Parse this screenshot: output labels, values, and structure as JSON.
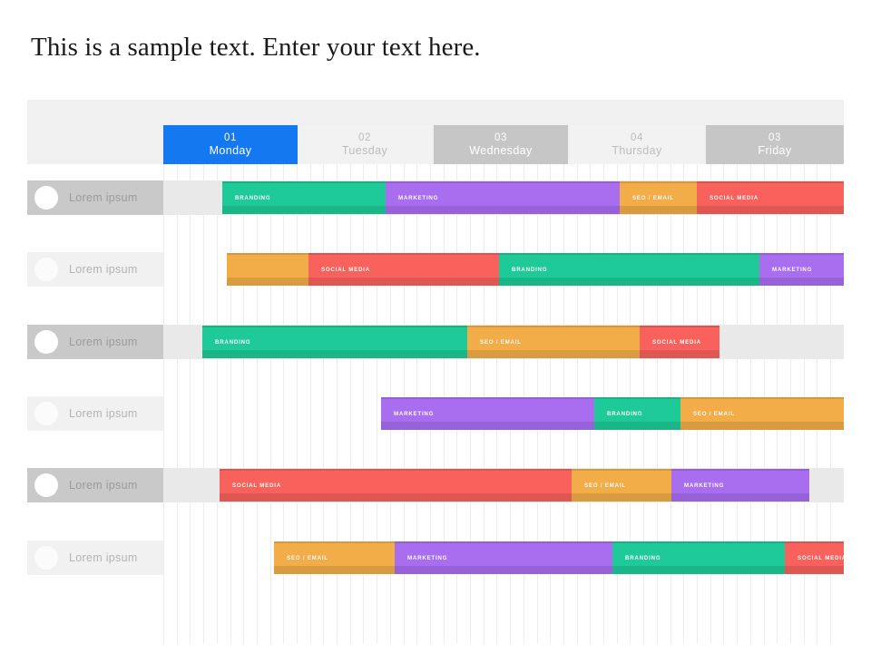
{
  "title": "This is a sample text. Enter your text here.",
  "colors": {
    "accent": "#1478f0",
    "branding": "#1ecb98",
    "marketing": "#a96ef0",
    "editorial": "#f2ad48",
    "social": "#f9615c",
    "header_light": "#f2f2f2",
    "header_dark": "#c6c6c6",
    "row_dark": "#c9c9c9",
    "row_light": "#f1f1f1"
  },
  "header": {
    "days": [
      {
        "num": "01",
        "name": "Monday",
        "state": "active"
      },
      {
        "num": "02",
        "name": "Tuesday",
        "state": "light"
      },
      {
        "num": "03",
        "name": "Wednesday",
        "state": "dark"
      },
      {
        "num": "04",
        "name": "Thursday",
        "state": "light"
      },
      {
        "num": "03",
        "name": "Friday",
        "state": "dark"
      }
    ]
  },
  "sidebar": {
    "rows": [
      {
        "label": "Lorem ipsum",
        "style": "dark"
      },
      {
        "label": "Lorem ipsum",
        "style": "lite"
      },
      {
        "label": "Lorem ipsum",
        "style": "dark"
      },
      {
        "label": "Lorem ipsum",
        "style": "lite"
      },
      {
        "label": "Lorem ipsum",
        "style": "dark"
      },
      {
        "label": "Lorem ipsum",
        "style": "lite"
      }
    ]
  },
  "chart_data": {
    "type": "bar",
    "title": "This is a sample text. Enter your text here.",
    "xlabel": "",
    "ylabel": "",
    "grid": true,
    "legend_position": "none",
    "categories": [
      "01 Monday",
      "02 Tuesday",
      "03 Wednesday",
      "04 Thursday",
      "03 Friday"
    ],
    "x_tick_labels": [
      "01",
      "02",
      "03",
      "04",
      "03"
    ],
    "axis_day_names": [
      "Monday",
      "Tuesday",
      "Wednesday",
      "Thursday",
      "Friday"
    ],
    "task_types": [
      "BRANDING",
      "MARKETING",
      "SEO / EMAIL",
      "SOCIAL MEDIA"
    ],
    "task_colors": {
      "BRANDING": "#1ecb98",
      "MARKETING": "#a96ef0",
      "SEO / EMAIL": "#f2ad48",
      "SOCIAL MEDIA": "#f9615c"
    },
    "rows": [
      {
        "name": "Lorem ipsum",
        "segments": [
          {
            "label": "BRANDING",
            "type": "BRANDING",
            "start": 65,
            "end": 245
          },
          {
            "label": "MARKETING",
            "type": "MARKETING",
            "start": 245,
            "end": 503
          },
          {
            "label": "SEO / EMAIL",
            "type": "SEO / EMAIL",
            "start": 503,
            "end": 588
          },
          {
            "label": "SOCIAL MEDIA",
            "type": "SOCIAL MEDIA",
            "start": 588,
            "end": 770
          }
        ]
      },
      {
        "name": "Lorem ipsum",
        "segments": [
          {
            "label": "",
            "type": "SEO / EMAIL",
            "start": 70,
            "end": 160
          },
          {
            "label": "SOCIAL MEDIA",
            "type": "SOCIAL MEDIA",
            "start": 160,
            "end": 370
          },
          {
            "label": "BRANDING",
            "type": "BRANDING",
            "start": 370,
            "end": 657
          },
          {
            "label": "MARKETING",
            "type": "MARKETING",
            "start": 657,
            "end": 750
          }
        ]
      },
      {
        "name": "Lorem ipsum",
        "segments": [
          {
            "label": "BRANDING",
            "type": "BRANDING",
            "start": 43,
            "end": 335
          },
          {
            "label": "SEO / EMAIL",
            "type": "SEO / EMAIL",
            "start": 335,
            "end": 525
          },
          {
            "label": "SOCIAL MEDIA",
            "type": "SOCIAL MEDIA",
            "start": 525,
            "end": 613
          }
        ]
      },
      {
        "name": "Lorem ipsum",
        "segments": [
          {
            "label": "MARKETING",
            "type": "MARKETING",
            "start": 240,
            "end": 475
          },
          {
            "label": "BRANDING",
            "type": "BRANDING",
            "start": 475,
            "end": 570
          },
          {
            "label": "SEO / EMAIL",
            "type": "SEO / EMAIL",
            "start": 570,
            "end": 756
          }
        ]
      },
      {
        "name": "Lorem ipsum",
        "segments": [
          {
            "label": "SOCIAL MEDIA",
            "type": "SOCIAL MEDIA",
            "start": 62,
            "end": 450
          },
          {
            "label": "SEO / EMAIL",
            "type": "SEO / EMAIL",
            "start": 450,
            "end": 560
          },
          {
            "label": "MARKETING",
            "type": "MARKETING",
            "start": 560,
            "end": 712
          }
        ]
      },
      {
        "name": "Lorem ipsum",
        "segments": [
          {
            "label": "SEO / EMAIL",
            "type": "SEO / EMAIL",
            "start": 122,
            "end": 255
          },
          {
            "label": "MARKETING",
            "type": "MARKETING",
            "start": 255,
            "end": 495
          },
          {
            "label": "BRANDING",
            "type": "BRANDING",
            "start": 495,
            "end": 685
          },
          {
            "label": "SOCIAL MEDIA",
            "type": "SOCIAL MEDIA",
            "start": 685,
            "end": 770
          }
        ]
      }
    ]
  }
}
